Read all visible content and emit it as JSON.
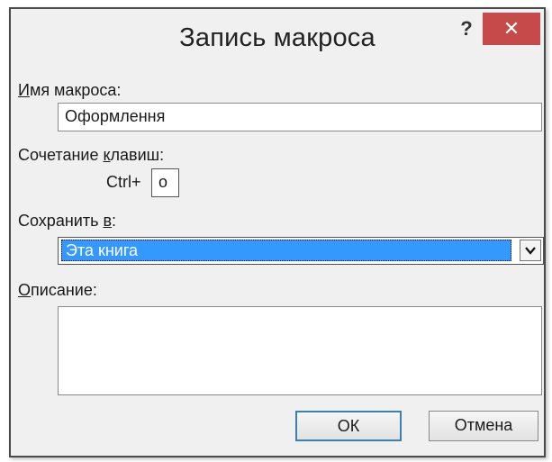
{
  "window": {
    "title": "Запись макроса",
    "help_label": "?",
    "close_label": "✕"
  },
  "macro_name": {
    "label_hotkey": "И",
    "label_rest": "мя макроса:",
    "value": "Оформлення"
  },
  "shortcut": {
    "label_pre": "Сочетание ",
    "label_hotkey": "к",
    "label_post": "лавиш:",
    "prefix": "Ctrl+",
    "key": "o"
  },
  "store_in": {
    "label_pre": "Сохранить ",
    "label_hotkey": "в",
    "label_post": ":",
    "selected": "Эта книга",
    "arrow_icon": "chevron-down-icon"
  },
  "description": {
    "label_hotkey": "О",
    "label_rest": "писание:",
    "value": ""
  },
  "buttons": {
    "ok": "ОК",
    "cancel": "Отмена"
  },
  "colors": {
    "selection": "#3399ff",
    "close_button": "#c74a4a",
    "dialog_bg": "#f0f0f0"
  }
}
